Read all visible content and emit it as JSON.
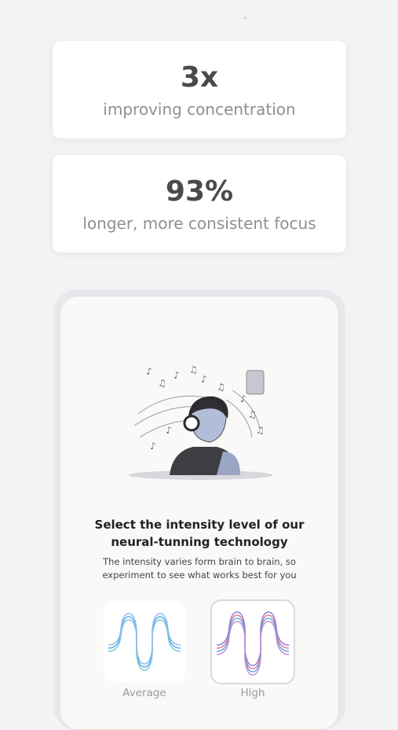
{
  "stats": [
    {
      "value": "3x",
      "caption": "improving concentration"
    },
    {
      "value": "93%",
      "caption": "longer, more consistent focus"
    }
  ],
  "phone": {
    "title": "Select the intensity level of our neural-tunning technology",
    "subtitle": "The intensity varies form brain to brain, so experiment to see what works best for you",
    "options": [
      {
        "label": "Average",
        "selected": false
      },
      {
        "label": "High",
        "selected": true
      }
    ]
  },
  "colors": {
    "background": "#f3f3f4",
    "wave_blue": "#5aa9e6",
    "wave_red": "#e07a8e",
    "wave_purple": "#8c7bd6"
  }
}
